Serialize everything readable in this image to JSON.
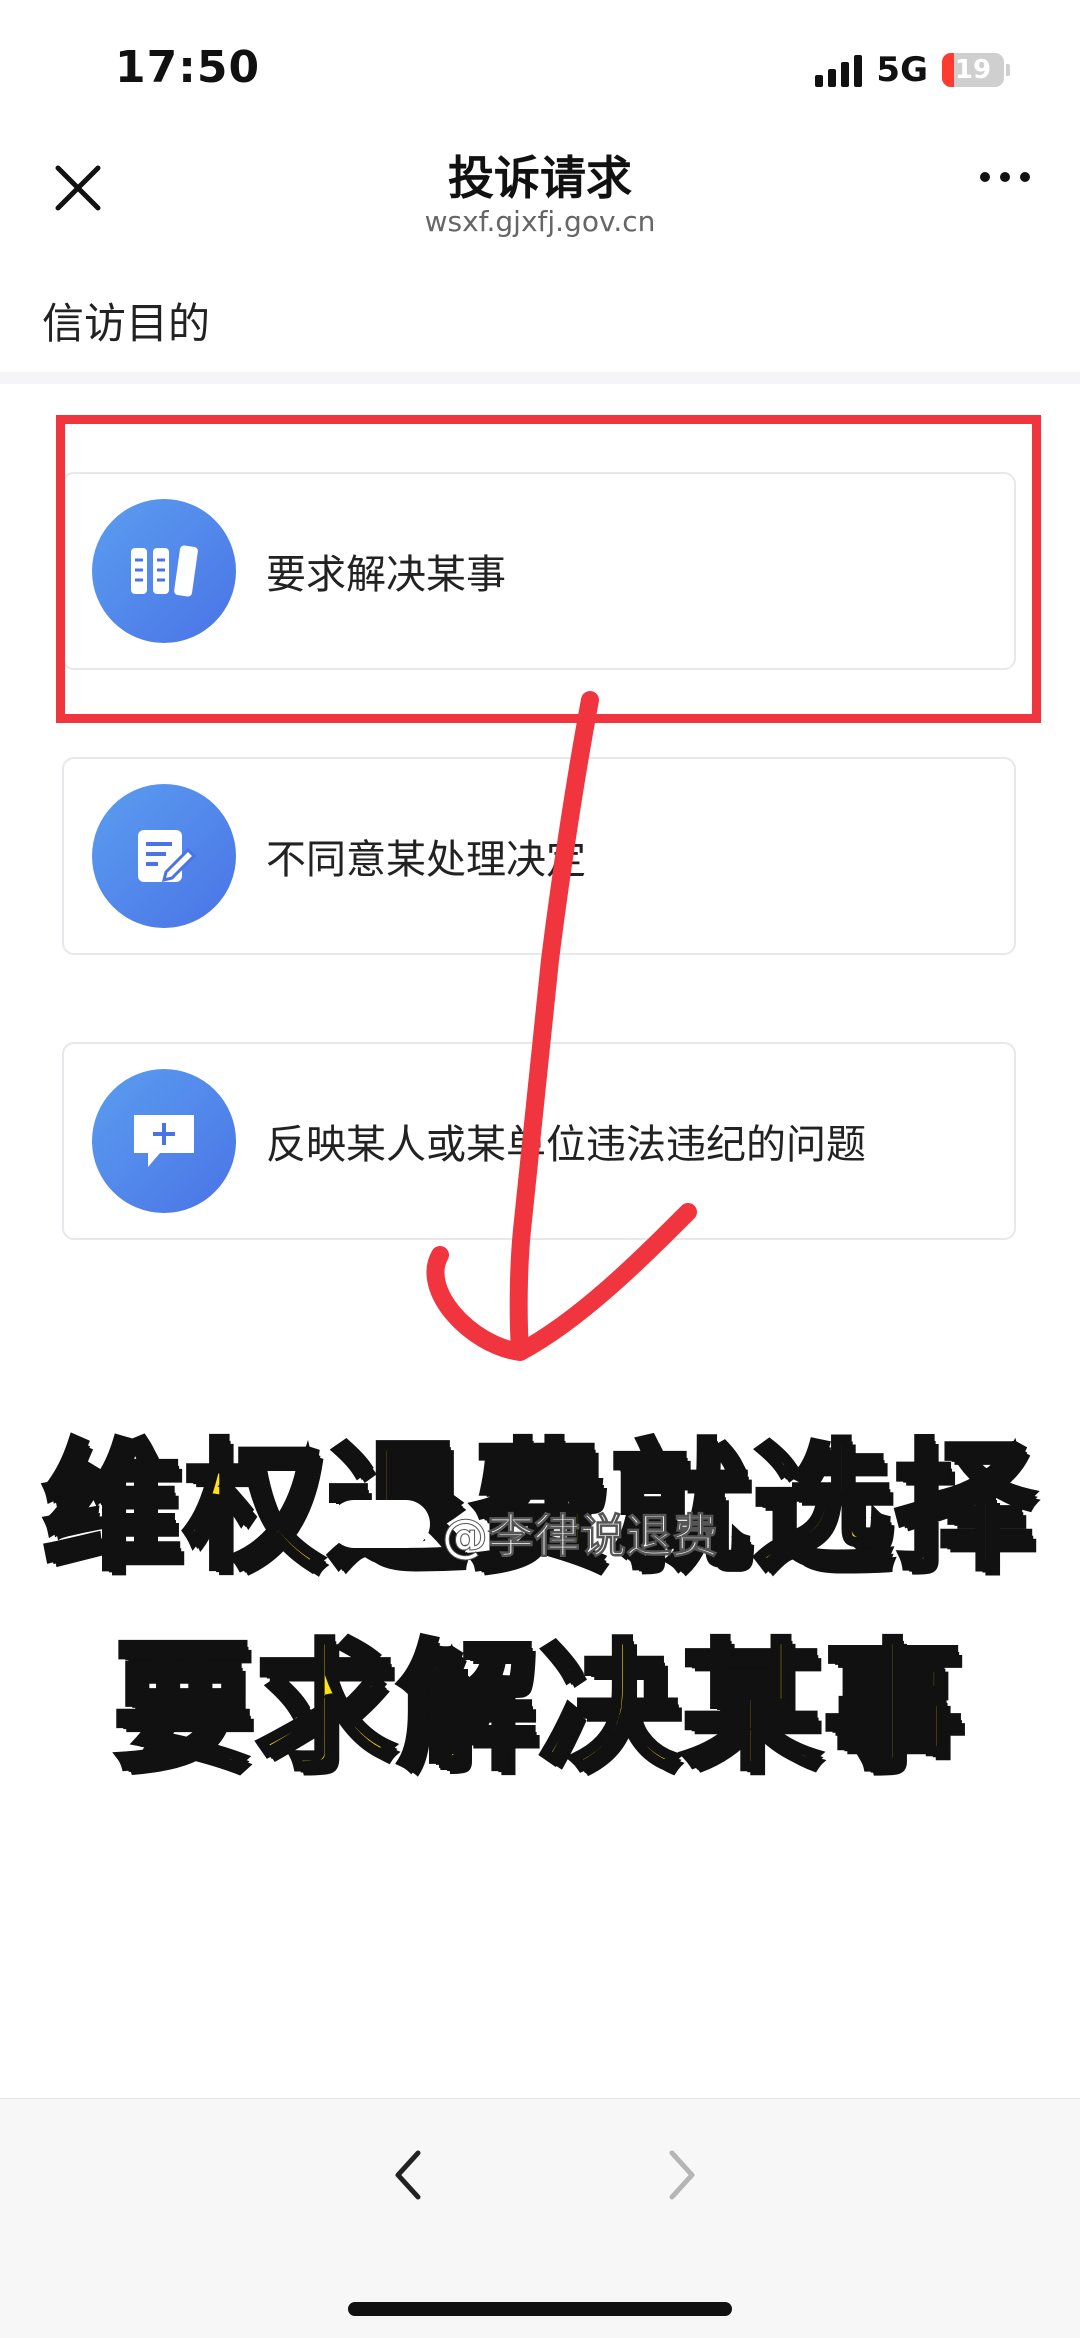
{
  "status_bar": {
    "time": "17:50",
    "network": "5G",
    "battery": "19"
  },
  "header": {
    "title": "投诉请求",
    "url": "wsxf.gjxfj.gov.cn"
  },
  "section": {
    "label": "信访目的"
  },
  "options": [
    {
      "label": "要求解决某事",
      "icon": "list-columns-icon"
    },
    {
      "label": "不同意某处理决定",
      "icon": "edit-document-icon"
    },
    {
      "label": "反映某人或某单位违法违纪的问题",
      "icon": "chat-add-icon"
    }
  ],
  "overlay": {
    "caption_line1": "维权退费就选择",
    "caption_line2": "要求解决某事",
    "watermark": "@李律说退费",
    "highlight_color": "#f0353f",
    "caption_color": "#ffe21a"
  },
  "colors": {
    "accent": "#4a73e6",
    "background": "#ffffff"
  }
}
